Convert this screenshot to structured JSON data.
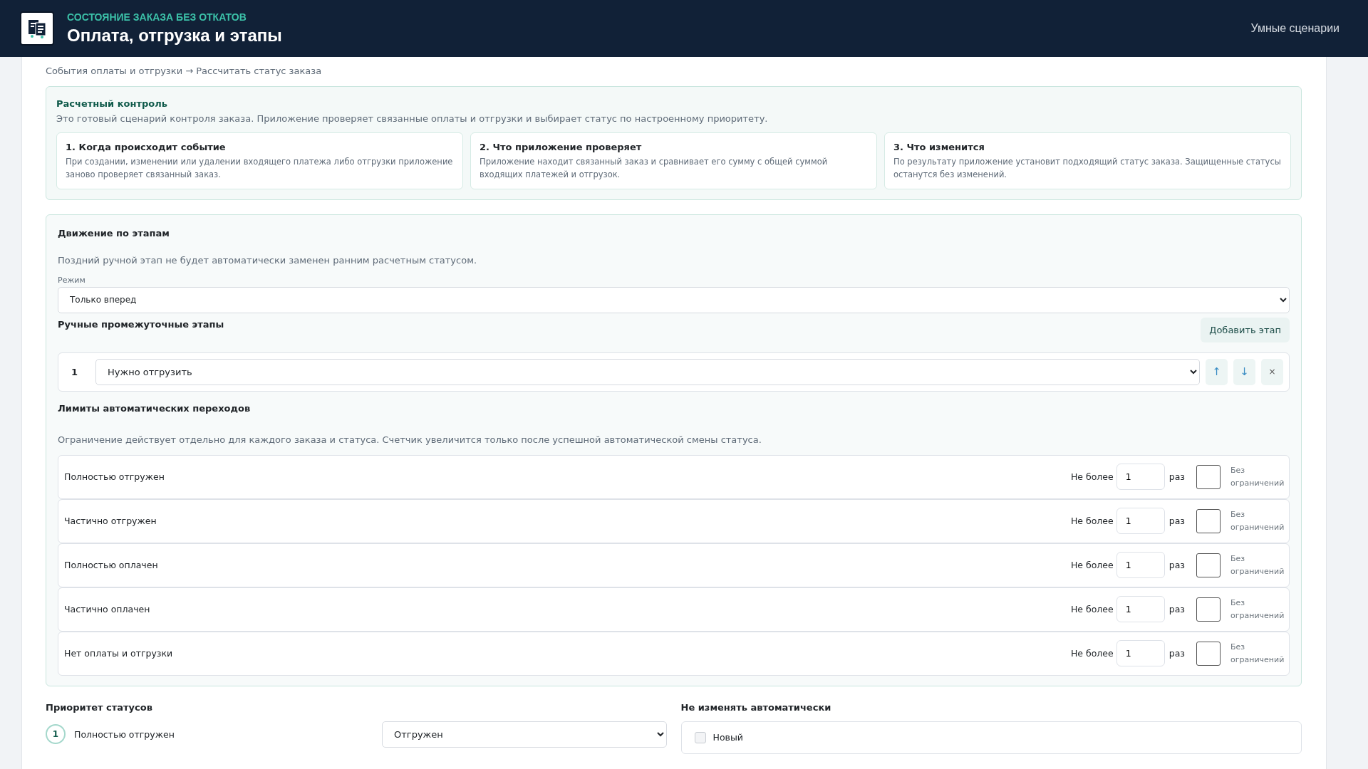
{
  "header": {
    "eyebrow": "СОСТОЯНИЕ ЗАКАЗА БЕЗ ОТКАТОВ",
    "title": "Оплата, отгрузка и этапы",
    "nav_link": "Умные сценарии"
  },
  "breadcrumb": "События оплаты и отгрузки → Рассчитать статус заказа",
  "control": {
    "title": "Расчетный контроль",
    "description": "Это готовый сценарий контроля заказа. Приложение проверяет связанные оплаты и отгрузки и выбирает статус по настроенному приоритету.",
    "steps": [
      {
        "title": "1. Когда происходит событие",
        "text": "При создании, изменении или удалении входящего платежа либо отгрузки приложение заново проверяет связанный заказ."
      },
      {
        "title": "2. Что приложение проверяет",
        "text": "Приложение находит связанный заказ и сравнивает его сумму с общей суммой входящих платежей и отгрузок."
      },
      {
        "title": "3. Что изменится",
        "text": "По результату приложение установит подходящий статус заказа. Защищенные статусы останутся без изменений."
      }
    ]
  },
  "stages": {
    "title": "Движение по этапам",
    "note": "Поздний ручной этап не будет автоматически заменен ранним расчетным статусом.",
    "mode_label": "Режим",
    "mode_value": "Только вперед",
    "manual_title": "Ручные промежуточные этапы",
    "add_button": "Добавить этап",
    "manual_stages": [
      {
        "number": "1",
        "value": "Нужно отгрузить",
        "up": "↑",
        "down": "↓",
        "remove": "×"
      }
    ],
    "limits_title": "Лимиты автоматических переходов",
    "limits_note": "Ограничение действует отдельно для каждого заказа и статуса. Счетчик увеличится только после успешной автоматической смены статуса.",
    "limits": [
      {
        "status": "Полностью отгружен",
        "prefix": "Не более",
        "value": "1",
        "suffix": "раз",
        "unlimited_label": "Без ограничений",
        "unlimited": false
      },
      {
        "status": "Частично отгружен",
        "prefix": "Не более",
        "value": "1",
        "suffix": "раз",
        "unlimited_label": "Без ограничений",
        "unlimited": false
      },
      {
        "status": "Полностью оплачен",
        "prefix": "Не более",
        "value": "1",
        "suffix": "раз",
        "unlimited_label": "Без ограничений",
        "unlimited": false
      },
      {
        "status": "Частично оплачен",
        "prefix": "Не более",
        "value": "1",
        "suffix": "раз",
        "unlimited_label": "Без ограничений",
        "unlimited": false
      },
      {
        "status": "Нет оплаты и отгрузки",
        "prefix": "Не более",
        "value": "1",
        "suffix": "раз",
        "unlimited_label": "Без ограничений",
        "unlimited": false
      }
    ]
  },
  "priority": {
    "title": "Приоритет статусов",
    "items": [
      {
        "number": "1",
        "status": "Полностью отгружен",
        "target": "Отгружен"
      }
    ]
  },
  "protected": {
    "title": "Не изменять автоматически",
    "items": [
      {
        "label": "Новый",
        "checked": false
      }
    ]
  }
}
